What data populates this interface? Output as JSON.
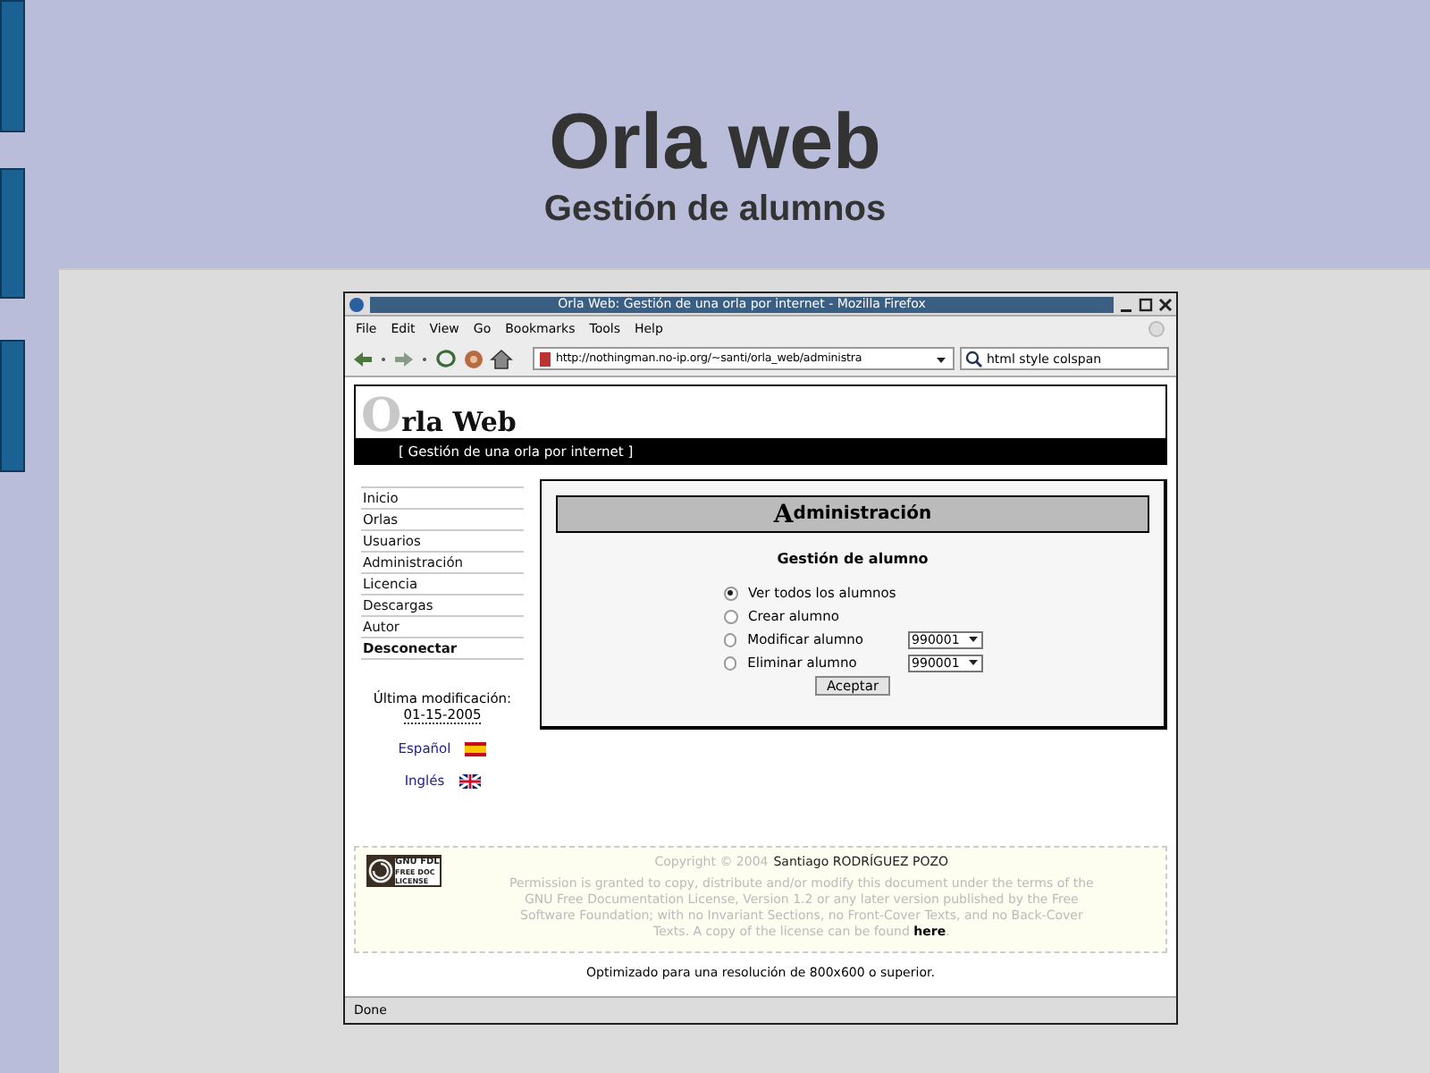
{
  "slide": {
    "title": "Orla web",
    "subtitle": "Gestión de alumnos"
  },
  "browser": {
    "title": "Orla Web: Gestión de una orla por internet - Mozilla Firefox",
    "menu": [
      "File",
      "Edit",
      "View",
      "Go",
      "Bookmarks",
      "Tools",
      "Help"
    ],
    "url": "http://nothingman.no-ip.org/~santi/orla_web/administra",
    "search_value": "html style colspan",
    "status": "Done"
  },
  "page": {
    "logo_initial": "O",
    "logo_rest": "rla Web",
    "tagline": "[ Gestión de una orla por internet ]",
    "nav": [
      {
        "label": "Inicio",
        "bold": false
      },
      {
        "label": "Orlas",
        "bold": false
      },
      {
        "label": "Usuarios",
        "bold": false
      },
      {
        "label": "Administración",
        "bold": false
      },
      {
        "label": "Licencia",
        "bold": false
      },
      {
        "label": "Descargas",
        "bold": false
      },
      {
        "label": "Autor",
        "bold": false
      },
      {
        "label": "Desconectar",
        "bold": true
      }
    ],
    "last_mod_label": "Última modificación:",
    "last_mod_date": "01-15-2005",
    "languages": [
      {
        "label": "Español",
        "kind": "es"
      },
      {
        "label": "Inglés",
        "kind": "uk"
      }
    ],
    "admin": {
      "heading_initial": "A",
      "heading_rest": "dministración",
      "subtitle": "Gestión de alumno",
      "options": [
        {
          "label": "Ver todos los alumnos",
          "selected": true
        },
        {
          "label": "Crear alumno",
          "selected": false
        },
        {
          "label": "Modificar alumno",
          "selected": false,
          "select_value": "990001"
        },
        {
          "label": "Eliminar alumno",
          "selected": false,
          "select_value": "990001"
        }
      ],
      "button": "Aceptar"
    },
    "footer": {
      "license_badge": [
        "GNU FDL",
        "FREE DOC",
        "LICENSE"
      ],
      "copyright_prefix": "Copyright © 2004",
      "author": "Santiago RODRÍGUEZ POZO",
      "license_text": "Permission is granted to copy, distribute and/or modify this document under the terms of the GNU Free Documentation License, Version 1.2 or any later version published by the Free Software Foundation; with no Invariant Sections, no Front-Cover Texts, and no Back-Cover Texts. A copy of the license can be found",
      "license_link": "here",
      "license_end": ".",
      "optimized": "Optimizado para una resolución de 800x600 o superior."
    }
  }
}
